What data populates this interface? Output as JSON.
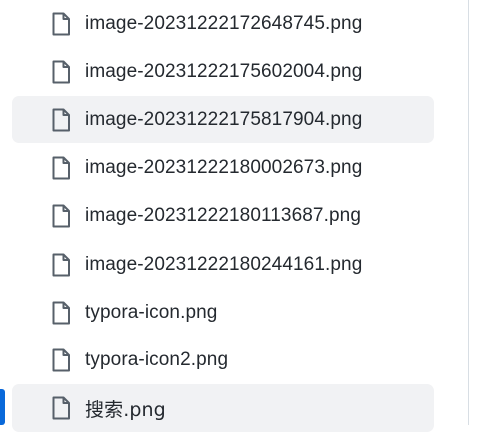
{
  "file_tree": {
    "items": [
      {
        "label": "image-20231222172648745.png",
        "icon": "file-icon"
      },
      {
        "label": "image-20231222175602004.png",
        "icon": "file-icon"
      },
      {
        "label": "image-20231222175817904.png",
        "icon": "file-icon"
      },
      {
        "label": "image-20231222180002673.png",
        "icon": "file-icon"
      },
      {
        "label": "image-20231222180113687.png",
        "icon": "file-icon"
      },
      {
        "label": "image-20231222180244161.png",
        "icon": "file-icon"
      },
      {
        "label": "typora-icon.png",
        "icon": "file-icon"
      },
      {
        "label": "typora-icon2.png",
        "icon": "file-icon"
      },
      {
        "label": "搜索.png",
        "icon": "file-icon"
      }
    ]
  },
  "colors": {
    "text": "#24292f",
    "icon": "#57606a",
    "hover_background": "#f1f2f4",
    "active_indicator": "#0969da",
    "border": "#d8dee4"
  }
}
